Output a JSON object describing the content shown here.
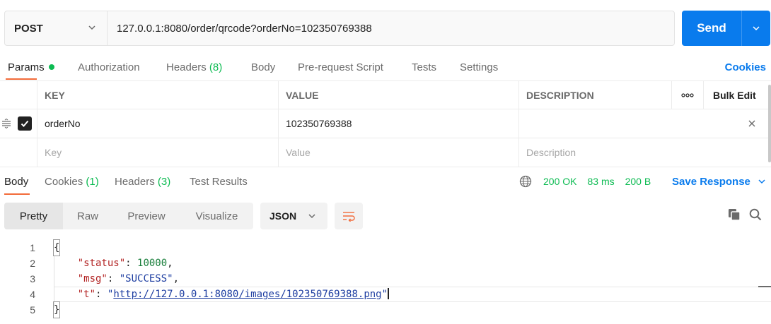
{
  "request": {
    "method": "POST",
    "url": "127.0.0.1:8080/order/qrcode?orderNo=102350769388",
    "send_label": "Send"
  },
  "request_tabs": {
    "params": "Params",
    "authorization": "Authorization",
    "headers": "Headers",
    "headers_count": "(8)",
    "body": "Body",
    "prerequest": "Pre-request Script",
    "tests": "Tests",
    "settings": "Settings",
    "cookies": "Cookies"
  },
  "params_table": {
    "headers": {
      "key": "KEY",
      "value": "VALUE",
      "description": "DESCRIPTION",
      "more": "ooo",
      "bulk_edit": "Bulk Edit"
    },
    "rows": [
      {
        "key": "orderNo",
        "value": "102350769388",
        "description": "",
        "checked": true
      }
    ],
    "placeholders": {
      "key": "Key",
      "value": "Value",
      "description": "Description"
    }
  },
  "response_tabs": {
    "body": "Body",
    "cookies": "Cookies",
    "cookies_count": "(1)",
    "headers": "Headers",
    "headers_count": "(3)",
    "test_results": "Test Results"
  },
  "response_status": {
    "status": "200 OK",
    "time": "83 ms",
    "size": "200 B",
    "save_response": "Save Response"
  },
  "view_modes": {
    "pretty": "Pretty",
    "raw": "Raw",
    "preview": "Preview",
    "visualize": "Visualize",
    "format": "JSON"
  },
  "response_body": {
    "line_numbers": [
      "1",
      "2",
      "3",
      "4",
      "5"
    ],
    "open_brace": "{",
    "close_brace": "}",
    "status_key": "\"status\"",
    "status_value": "10000",
    "msg_key": "\"msg\"",
    "msg_value": "\"SUCCESS\"",
    "t_key": "\"t\"",
    "t_value": "http://127.0.0.1:8080/images/102350769388.png"
  },
  "colors": {
    "accent_blue": "#097bed",
    "success_green": "#0cbb52",
    "active_tab_orange": "#f26b3a"
  }
}
